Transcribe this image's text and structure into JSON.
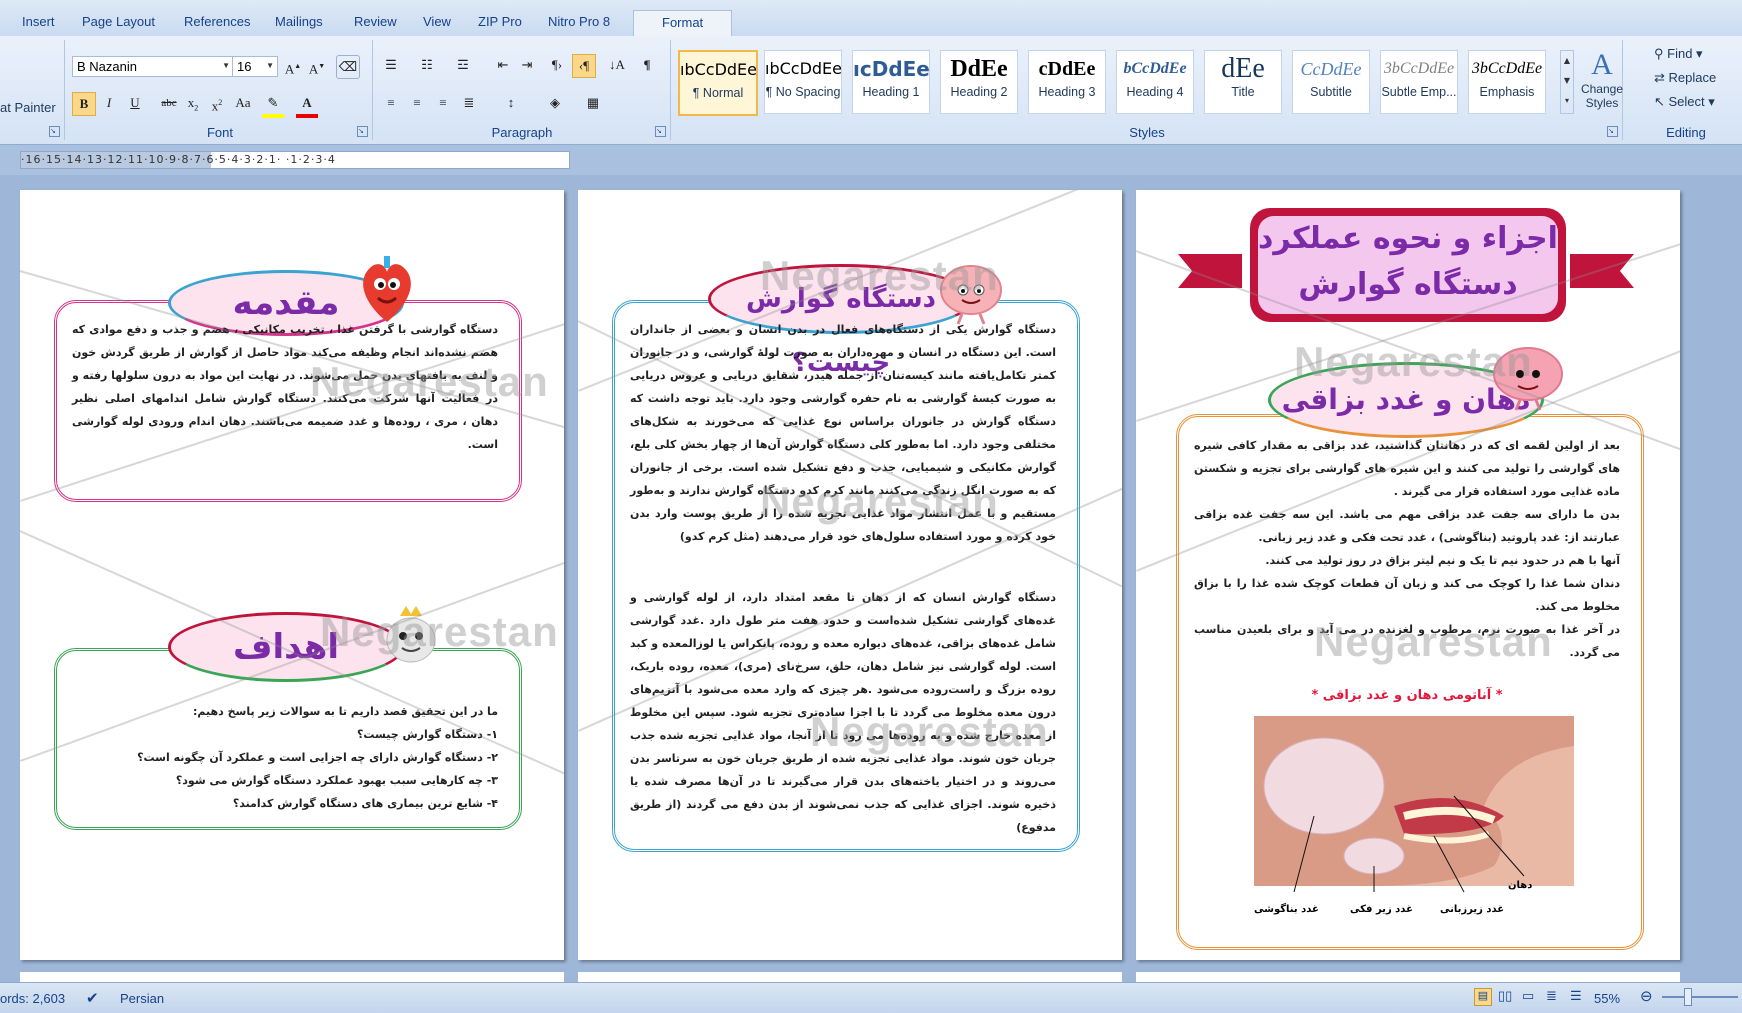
{
  "ribbon": {
    "tabs": [
      "Insert",
      "Page Layout",
      "References",
      "Mailings",
      "Review",
      "View",
      "ZIP Pro",
      "Nitro Pro 8"
    ],
    "context_tab": "Format",
    "clipboard": {
      "format_painter": "at Painter"
    },
    "font": {
      "name": "B Nazanin",
      "size": "16",
      "label": "Font"
    },
    "paragraph": {
      "label": "Paragraph"
    },
    "styles": {
      "label": "Styles",
      "items": [
        {
          "preview": "ıbCcDdEe",
          "name": "¶ Normal"
        },
        {
          "preview": "ıbCcDdEe",
          "name": "¶ No Spacing"
        },
        {
          "preview": "ıcDdEe",
          "name": "Heading 1"
        },
        {
          "preview": "DdEe",
          "name": "Heading 2"
        },
        {
          "preview": "cDdEe",
          "name": "Heading 3"
        },
        {
          "preview": "bCcDdEe",
          "name": "Heading 4"
        },
        {
          "preview": "dEe",
          "name": "Title"
        },
        {
          "preview": "CcDdEe",
          "name": "Subtitle"
        },
        {
          "preview": "3bCcDdEe",
          "name": "Subtle Emp..."
        },
        {
          "preview": "3bCcDdEe",
          "name": "Emphasis"
        }
      ],
      "change_styles": "Change Styles"
    },
    "editing": {
      "label": "Editing",
      "find": "Find",
      "replace": "Replace",
      "select": "Select"
    }
  },
  "ruler": {
    "text": "·16·15·14·13·12·11·10·9·8·7·6·5·4·3·2·1·  ·1·2·3·4"
  },
  "watermark": "Negarestan",
  "pages": {
    "left": {
      "intro_title": "مقدمه",
      "intro_text": "دستگاه گوارشی با گرفتن غذا ، تخریب مکانیکی ، هضم و جذب و دفع موادی که هضم نشده‌اند انجام وظیفه می‌کند مواد حاصل از گوارش از طریق گردش خون و لنف به بافتهای بدن حمل می‌شوند. در نهایت این مواد به درون سلولها رفته و در فعالیت آنها شرکت می‌کنند. دستگاه گوارش شامل اندامهای اصلی نظیر دهان ، مری ، روده‌ها و غدد ضمیمه می‌باشند. دهان اندام ورودی لوله گوارشی است.",
      "goals_title": "اهداف",
      "goals_lines": [
        "ما در این تحقیق قصد داریم تا به سوالات زیر پاسخ دهیم:",
        "۱- دستگاه گوارش چیست؟",
        "۲- دستگاه گوارش دارای چه اجزایی است و عملکرد آن چگونه است؟",
        "۳- چه کارهایی سبب بهبود عملکرد دستگاه گوارش می شود؟",
        "۴- شایع ترین بیماری های دستگاه گوارش کدامند؟"
      ]
    },
    "middle": {
      "title": "دستگاه گوارش چیست؟",
      "para1": "دستگاه گوارش یکی از دستگاه‌های فعال در بدن انسان و بعضی از جانداران است. این دستگاه در انسان و مهره‌داران به صورت لولهٔ گوارشی، و در جانوران کمتر تکامل‌یافته مانند کیسه‌تنان از جمله هیدر، شقایق دریایی و عروس دریایی به صورت کیسهٔ گوارشی به نام حفره گوارشی وجود دارد. باید توجه داشت که دستگاه گوارش در جانوران براساس نوع غذایی که می‌خورند به شکل‌های مختلفی وجود دارد. اما به‌طور کلی دستگاه گوارش آن‌ها از چهار بخش کلی بلع، گوارش مکانیکی و شیمیایی، جذب و دفع تشکیل شده است. برخی از جانوران که به صورت انگل زندگی می‌کنند مانند کرم کدو دستگاه گوارش ندارند و به‌طور مستقیم و با عمل انتشار مواد غذایی تجزیه شده را از طریق پوست وارد بدن خود کرده و مورد استفاده سلول‌های خود قرار می‌دهند (مثل کرم کدو)",
      "para2": "دستگاه گوارش انسان که از دهان تا مقعد امتداد دارد، از لوله گوارشی و غده‌های گوارشی تشکیل شده‌است و حدود هفت متر طول دارد .غدد گوارشی شامل غده‌های بزاقی، غده‌های دیواره معده و روده، پانکراس یا لوزالمعده و کبد است. لوله گوارشی نیز شامل دهان، حلق، سرخ‌نای (مری)، معده، روده باریک، روده بزرگ و راست‌روده می‌شود .هر چیزی که وارد معده می‌شود با آنزیم‌های درون معده مخلوط می گردد تا با اجزا ساده‌تری تجزیه شود. سپس این مخلوط از معده خارج شده و به روده‌ها می رود تا از آنجا، مواد غذایی تجزیه شده جذب جریان خون شوند. مواد غذایی تجزیه شده از طریق جریان خون به سرتاسر بدن می‌روند و در اختیار یاخته‌های بدن قرار می‌گیرند تا در آن‌ها مصرف شده یا ذخیره شوند. اجزای غذایی که جذب نمی‌شوند از بدن دفع می گردند (از طریق مدفوع)"
    },
    "right": {
      "main_title_line1": "اجزاء و نحوه عملکرد",
      "main_title_line2": "دستگاه گوارش",
      "section_title": "دهان و غدد بزاقی",
      "paras": [
        "بعد از اولین لقمه ای که در دهانتان گذاشتید، غدد بزاقی به مقدار کافی شیره های گوارشی را تولید می کنند و این شیره های گوارشی برای تجزیه و شکستن ماده غذایی مورد استفاده قرار می گیرند .",
        "بدن ما دارای سه جفت غدد بزاقی مهم می باشد. این سه جفت غده بزاقی عبارتند از: غدد پاروتید (بناگوشی) ، غدد تحت فکی و غدد زیر زبانی.",
        "آنها با هم در حدود نیم تا یک و نیم لیتر بزاق در روز تولید می کنند.",
        "دندان شما غذا را کوچک می کند و زبان آن قطعات کوچک شده غذا را با بزاق مخلوط می کند.",
        "در آخر غذا به صورت نرم، مرطوب و لغزنده در می آید و برای بلعیدن مناسب می گردد."
      ],
      "figure_caption": "* آناتومی دهان و غدد بزاقی *",
      "figure_labels": {
        "mouth": "دهان",
        "parotid": "غدد بناگوشی",
        "submandibular": "غدد زیر فکی",
        "sublingual": "غدد زیرزبانی"
      }
    }
  },
  "status": {
    "words": "ords: 2,603",
    "language": "Persian",
    "zoom": "55%"
  },
  "colors": {
    "pink": "#d6338a",
    "green": "#3aa655",
    "blue": "#3aa3cf",
    "orange": "#e8923a",
    "purple": "#7b2aa8",
    "crimson": "#c0143c"
  }
}
